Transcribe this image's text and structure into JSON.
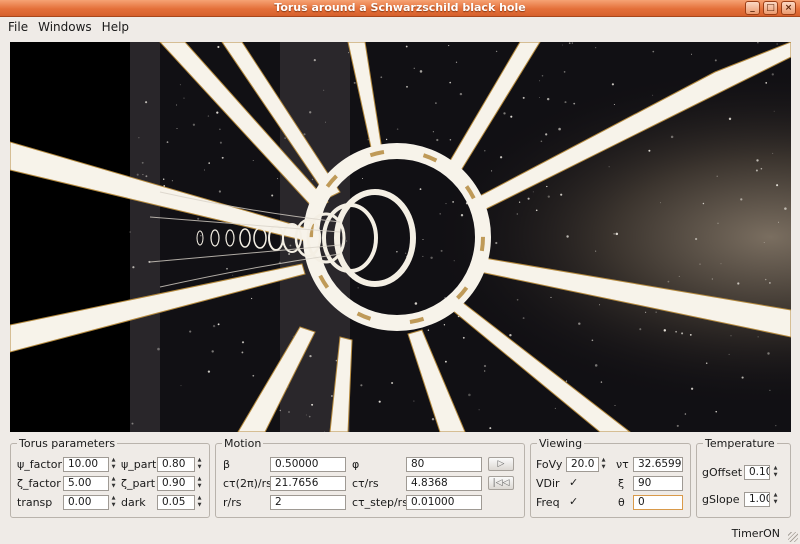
{
  "window": {
    "title": "Torus around a Schwarzschild black hole",
    "minimize_icon": "minimize-icon",
    "maximize_icon": "maximize-icon",
    "close_icon": "close-icon"
  },
  "menu": {
    "file": "File",
    "windows": "Windows",
    "help": "Help"
  },
  "viewport": {
    "colors": {
      "ring": "#f7f3ea",
      "gold": "#b58a3e",
      "sky": "#0b0a0d",
      "milkyway": "#6b6257"
    }
  },
  "torus": {
    "title": "Torus parameters",
    "psi_factor_label": "ψ_factor",
    "psi_factor_value": "10.00",
    "psi_part_label": "ψ_part",
    "psi_part_value": "0.80",
    "zeta_factor_label": "ζ_factor",
    "zeta_factor_value": "5.00",
    "zeta_part_label": "ζ_part",
    "zeta_part_value": "0.90",
    "transp_label": "transp",
    "transp_value": "0.00",
    "dark_label": "dark",
    "dark_value": "0.05"
  },
  "motion": {
    "title": "Motion",
    "beta_label": "β",
    "beta_value": "0.50000",
    "phi_label": "φ",
    "phi_value": "80",
    "ctau2pi_label": "cτ(2π)/rs",
    "ctau2pi_value": "21.7656",
    "ctau_label": "cτ/rs",
    "ctau_value": "4.8368",
    "r_label": "r/rs",
    "r_value": "2",
    "ctau_step_label": "cτ_step/rs",
    "ctau_step_value": "0.01000",
    "play_icon": "play-icon",
    "rewind_icon": "rewind-icon"
  },
  "viewing": {
    "title": "Viewing",
    "fovy_label": "FoVy",
    "fovy_value": "20.0",
    "nutau_label": "ντ",
    "nutau_value": "32.6599",
    "vdir_label": "VDir",
    "xi_label": "ξ",
    "xi_value": "90",
    "freq_label": "Freq",
    "theta_label": "θ",
    "theta_value": "0"
  },
  "temperature": {
    "title": "Temperature",
    "goffset_label": "gOffset",
    "goffset_value": "0.10",
    "gslope_label": "gSlope",
    "gslope_value": "1.00"
  },
  "status": {
    "text": "TimerON"
  }
}
